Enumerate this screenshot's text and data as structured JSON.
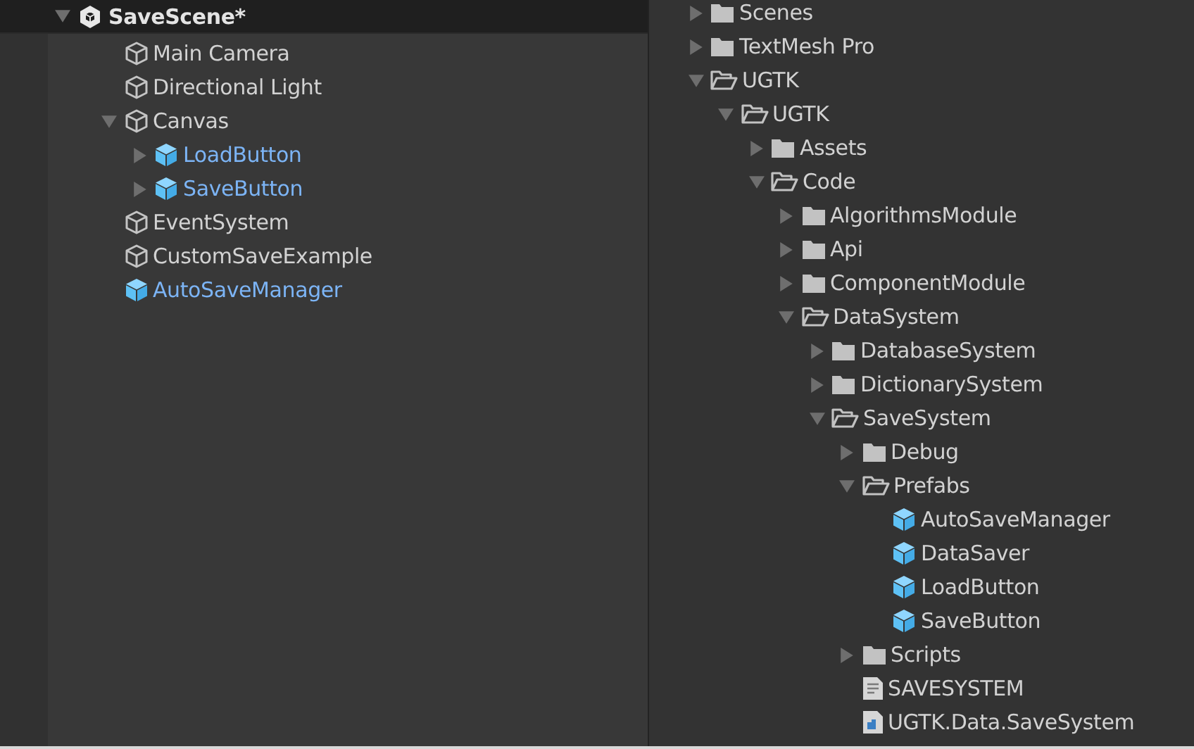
{
  "hierarchy": {
    "scene": {
      "name": "SaveScene*",
      "expanded": true,
      "children": [
        {
          "name": "Main Camera",
          "kind": "object"
        },
        {
          "name": "Directional Light",
          "kind": "object"
        },
        {
          "name": "Canvas",
          "kind": "object",
          "expanded": true,
          "children": [
            {
              "name": "LoadButton",
              "kind": "prefab",
              "expanded": false
            },
            {
              "name": "SaveButton",
              "kind": "prefab",
              "expanded": false
            }
          ]
        },
        {
          "name": "EventSystem",
          "kind": "object"
        },
        {
          "name": "CustomSaveExample",
          "kind": "object"
        },
        {
          "name": "AutoSaveManager",
          "kind": "prefab"
        }
      ]
    }
  },
  "project": {
    "items": [
      {
        "name": "Scenes",
        "kind": "folder",
        "expanded": false
      },
      {
        "name": "TextMesh Pro",
        "kind": "folder",
        "expanded": false
      },
      {
        "name": "UGTK",
        "kind": "folder",
        "expanded": true,
        "children": [
          {
            "name": "UGTK",
            "kind": "folder",
            "expanded": true,
            "children": [
              {
                "name": "Assets",
                "kind": "folder",
                "expanded": false
              },
              {
                "name": "Code",
                "kind": "folder",
                "expanded": true,
                "children": [
                  {
                    "name": "AlgorithmsModule",
                    "kind": "folder",
                    "expanded": false
                  },
                  {
                    "name": "Api",
                    "kind": "folder",
                    "expanded": false
                  },
                  {
                    "name": "ComponentModule",
                    "kind": "folder",
                    "expanded": false
                  },
                  {
                    "name": "DataSystem",
                    "kind": "folder",
                    "expanded": true,
                    "children": [
                      {
                        "name": "DatabaseSystem",
                        "kind": "folder",
                        "expanded": false
                      },
                      {
                        "name": "DictionarySystem",
                        "kind": "folder",
                        "expanded": false
                      },
                      {
                        "name": "SaveSystem",
                        "kind": "folder",
                        "expanded": true,
                        "children": [
                          {
                            "name": "Debug",
                            "kind": "folder",
                            "expanded": false
                          },
                          {
                            "name": "Prefabs",
                            "kind": "folder",
                            "expanded": true,
                            "children": [
                              {
                                "name": "AutoSaveManager",
                                "kind": "prefab"
                              },
                              {
                                "name": "DataSaver",
                                "kind": "prefab"
                              },
                              {
                                "name": "LoadButton",
                                "kind": "prefab"
                              },
                              {
                                "name": "SaveButton",
                                "kind": "prefab"
                              }
                            ]
                          },
                          {
                            "name": "Scripts",
                            "kind": "folder",
                            "expanded": false
                          },
                          {
                            "name": "SAVESYSTEM",
                            "kind": "text"
                          },
                          {
                            "name": "UGTK.Data.SaveSystem",
                            "kind": "assembly"
                          }
                        ]
                      }
                    ]
                  }
                ]
              }
            ]
          }
        ]
      }
    ]
  }
}
